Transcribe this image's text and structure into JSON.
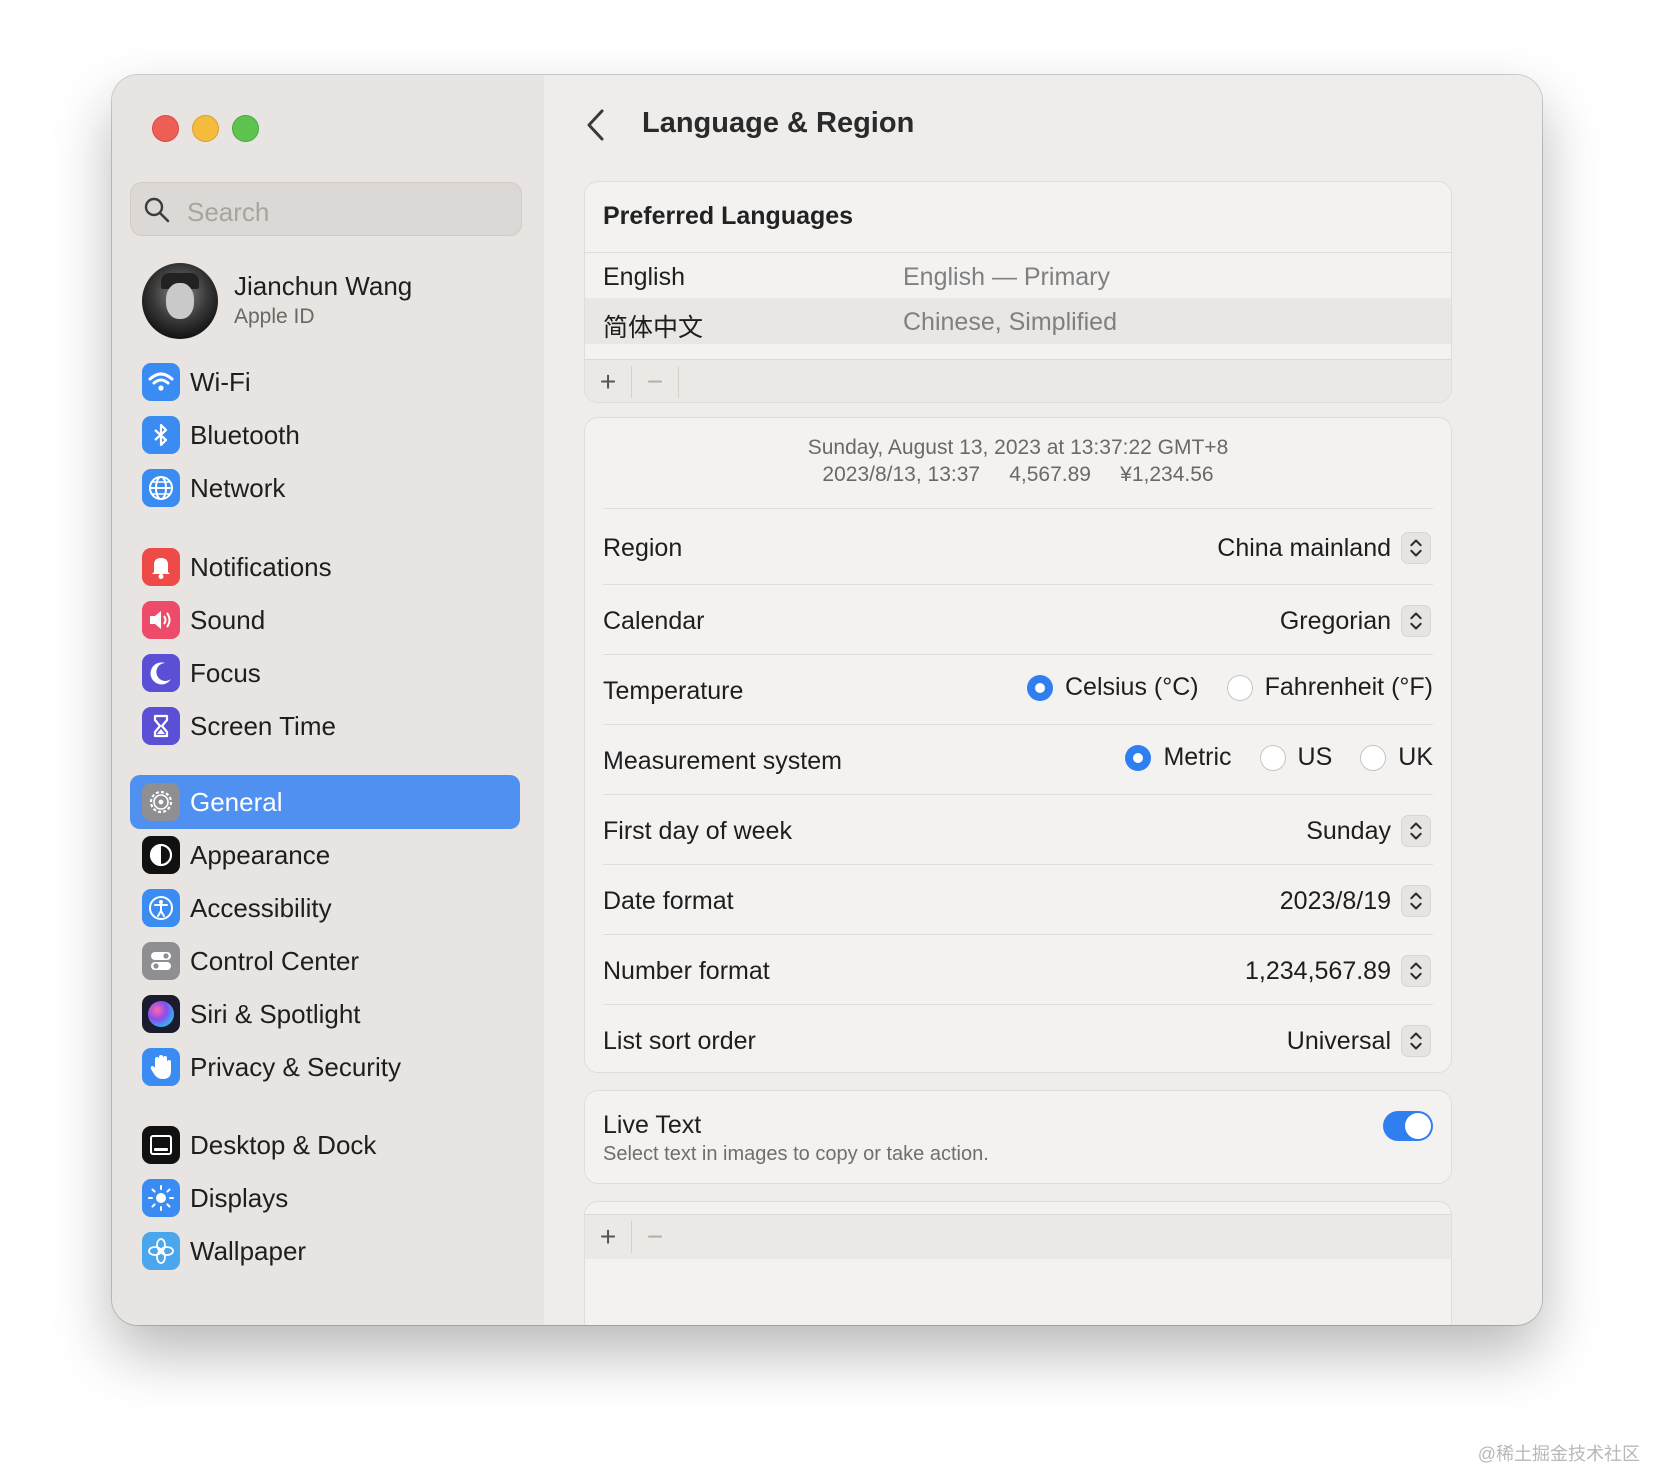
{
  "sidebar": {
    "search_placeholder": "Search",
    "profile": {
      "name": "Jianchun Wang",
      "subtitle": "Apple ID"
    },
    "items": [
      {
        "label": "Wi-Fi",
        "icon": "wifi-icon",
        "color": "#3b8cf2"
      },
      {
        "label": "Bluetooth",
        "icon": "bluetooth-icon",
        "color": "#3b8cf2"
      },
      {
        "label": "Network",
        "icon": "globe-icon",
        "color": "#3b8cf2"
      },
      {
        "label": "Notifications",
        "icon": "bell-icon",
        "color": "#ee4b48"
      },
      {
        "label": "Sound",
        "icon": "speaker-icon",
        "color": "#ee4b6a"
      },
      {
        "label": "Focus",
        "icon": "moon-icon",
        "color": "#5b4fd6"
      },
      {
        "label": "Screen Time",
        "icon": "hourglass-icon",
        "color": "#5b4fd6"
      },
      {
        "label": "General",
        "icon": "gear-icon",
        "color": "#8e8e93"
      },
      {
        "label": "Appearance",
        "icon": "appearance-icon",
        "color": "#111111"
      },
      {
        "label": "Accessibility",
        "icon": "accessibility-icon",
        "color": "#3b8cf2"
      },
      {
        "label": "Control Center",
        "icon": "toggles-icon",
        "color": "#8e8e93"
      },
      {
        "label": "Siri & Spotlight",
        "icon": "siri-icon",
        "color": "#6b39c9"
      },
      {
        "label": "Privacy & Security",
        "icon": "hand-icon",
        "color": "#3b8cf2"
      },
      {
        "label": "Desktop & Dock",
        "icon": "dock-icon",
        "color": "#111111"
      },
      {
        "label": "Displays",
        "icon": "sun-icon",
        "color": "#3b8cf2"
      },
      {
        "label": "Wallpaper",
        "icon": "flower-icon",
        "color": "#4aa7ee"
      }
    ],
    "selected": "General"
  },
  "main": {
    "title": "Language & Region",
    "preferred_languages": {
      "header": "Preferred Languages",
      "rows": [
        {
          "name": "English",
          "desc": "English — Primary"
        },
        {
          "name": "简体中文",
          "desc": "Chinese, Simplified"
        }
      ],
      "add": "+",
      "remove": "−"
    },
    "preview": {
      "line1": "Sunday, August 13, 2023 at 13:37:22 GMT+8",
      "line2": "2023/8/13, 13:37     4,567.89     ¥1,234.56"
    },
    "settings": [
      {
        "label": "Region",
        "value": "China mainland"
      },
      {
        "label": "Calendar",
        "value": "Gregorian"
      },
      {
        "label": "Temperature",
        "options": [
          "Celsius (°C)",
          "Fahrenheit (°F)"
        ],
        "selected": "Celsius (°C)"
      },
      {
        "label": "Measurement system",
        "options": [
          "Metric",
          "US",
          "UK"
        ],
        "selected": "Metric"
      },
      {
        "label": "First day of week",
        "value": "Sunday"
      },
      {
        "label": "Date format",
        "value": "2023/8/19"
      },
      {
        "label": "Number format",
        "value": "1,234,567.89"
      },
      {
        "label": "List sort order",
        "value": "Universal"
      }
    ],
    "live_text": {
      "title": "Live Text",
      "description": "Select text in images to copy or take action.",
      "enabled": true
    },
    "bottom_toolbar": {
      "add": "+",
      "remove": "−"
    }
  },
  "watermark": "@稀土掘金技术社区",
  "colors": {
    "accent": "#2f7ff0",
    "selection": "#4f90f0"
  }
}
